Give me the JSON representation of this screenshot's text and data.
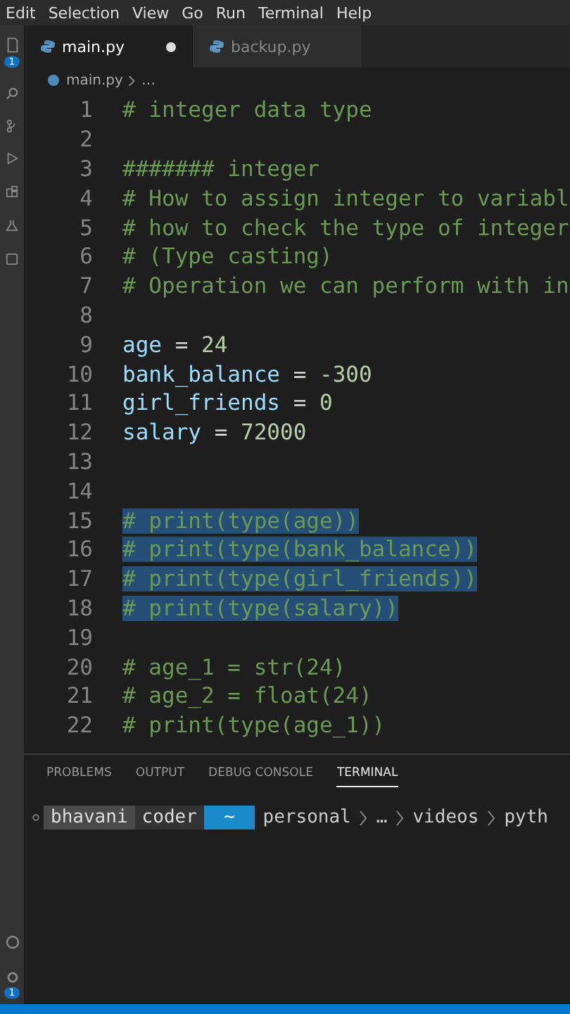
{
  "menu": [
    "Edit",
    "Selection",
    "View",
    "Go",
    "Run",
    "Terminal",
    "Help"
  ],
  "activity_badges": [
    {
      "count": "1"
    },
    {
      "count": "1"
    }
  ],
  "tabs": [
    {
      "label": "main.py",
      "selected": true,
      "modified": true
    },
    {
      "label": "backup.py",
      "selected": false,
      "modified": false
    }
  ],
  "breadcrumb": [
    "main.py",
    "…"
  ],
  "lines": [
    {
      "number": "1",
      "kind": "comment",
      "text": "# integer data type",
      "selected": false
    },
    {
      "number": "2",
      "kind": "blank",
      "selected": false
    },
    {
      "number": "3",
      "kind": "comment",
      "text": "####### integer",
      "selected": false
    },
    {
      "number": "4",
      "kind": "comment",
      "text": "# How to assign integer to variabl",
      "selected": false
    },
    {
      "number": "5",
      "kind": "comment",
      "text": "# how to check the type of integer",
      "selected": false
    },
    {
      "number": "6",
      "kind": "comment",
      "text": "# (Type casting)",
      "selected": false
    },
    {
      "number": "7",
      "kind": "comment",
      "text": "# Operation we can perform with in",
      "selected": false
    },
    {
      "number": "8",
      "kind": "blank",
      "selected": false
    },
    {
      "number": "9",
      "kind": "assign",
      "name": "age",
      "op": "=",
      "value": "24",
      "selected": false
    },
    {
      "number": "10",
      "kind": "assign",
      "name": "bank_balance",
      "op": "=",
      "value": "-300",
      "selected": false
    },
    {
      "number": "11",
      "kind": "assign",
      "name": "girl_friends",
      "op": "=",
      "value": "0",
      "selected": false
    },
    {
      "number": "12",
      "kind": "assign",
      "name": "salary",
      "op": "=",
      "value": "72000",
      "selected": false
    },
    {
      "number": "13",
      "kind": "blank",
      "selected": false
    },
    {
      "number": "14",
      "kind": "blank",
      "selected": false
    },
    {
      "number": "15",
      "kind": "comment",
      "text": "# print(type(age))",
      "selected": true
    },
    {
      "number": "16",
      "kind": "comment",
      "text": "# print(type(bank_balance))",
      "selected": true
    },
    {
      "number": "17",
      "kind": "comment",
      "text": "# print(type(girl_friends))",
      "selected": true
    },
    {
      "number": "18",
      "kind": "comment",
      "text": "# print(type(salary))",
      "selected": true
    },
    {
      "number": "19",
      "kind": "blank",
      "selected": false
    },
    {
      "number": "20",
      "kind": "comment",
      "text": "# age_1 = str(24)",
      "selected": false
    },
    {
      "number": "21",
      "kind": "comment",
      "text": "# age_2 = float(24)",
      "selected": false
    },
    {
      "number": "22",
      "kind": "comment",
      "text": "# print(type(age_1))",
      "selected": false
    }
  ],
  "panel_tabs": [
    {
      "label": "PROBLEMS",
      "selected": false
    },
    {
      "label": "OUTPUT",
      "selected": false
    },
    {
      "label": "DEBUG CONSOLE",
      "selected": false
    },
    {
      "label": "TERMINAL",
      "selected": true
    }
  ],
  "terminal": {
    "user": "bhavani",
    "host": "coder",
    "home": "~",
    "path": [
      "personal",
      "…",
      "videos",
      "pyth"
    ]
  }
}
